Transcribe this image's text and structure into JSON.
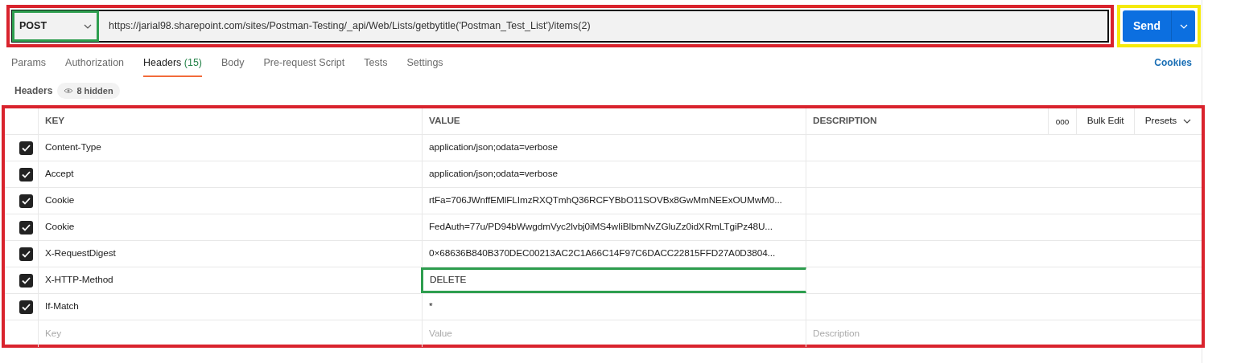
{
  "request": {
    "method": "POST",
    "url": "https://jarial98.sharepoint.com/sites/Postman-Testing/_api/Web/Lists/getbytitle('Postman_Test_List')/items(2)",
    "highlighted": true,
    "method_highlighted": true,
    "send": {
      "label": "Send",
      "highlighted": true
    }
  },
  "tabs": [
    {
      "label": "Params",
      "selected": false
    },
    {
      "label": "Authorization",
      "selected": false
    },
    {
      "label": "Headers",
      "count": "(15)",
      "selected": true
    },
    {
      "label": "Body",
      "selected": false
    },
    {
      "label": "Pre-request Script",
      "selected": false
    },
    {
      "label": "Tests",
      "selected": false
    },
    {
      "label": "Settings",
      "selected": false
    }
  ],
  "cookies_link": "Cookies",
  "headers_bar": {
    "title": "Headers",
    "hidden": "8 hidden"
  },
  "table": {
    "highlighted": true,
    "columns": [
      "KEY",
      "VALUE",
      "DESCRIPTION"
    ],
    "actions": {
      "more": "ooo",
      "bulk_edit": "Bulk Edit",
      "presets": "Presets"
    },
    "rows": [
      {
        "checked": true,
        "key": "Content-Type",
        "value": "application/json;odata=verbose"
      },
      {
        "checked": true,
        "key": "Accept",
        "value": "application/json;odata=verbose"
      },
      {
        "checked": true,
        "key": "Cookie",
        "value": "rtFa=706JWnffEMlFLImzRXQTmhQ36RCFYBbO11SOVBx8GwMmNEExOUMwM0..."
      },
      {
        "checked": true,
        "key": "Cookie",
        "value": "FedAuth=77u/PD94bWwgdmVyc2lvbj0iMS4wIiBlbmNvZGluZz0idXRmLTgiPz48U..."
      },
      {
        "checked": true,
        "key": "X-RequestDigest",
        "value": "0×68636B840B370DEC00213AC2C1A66C14F97C6DACC22815FFD27A0D3804..."
      },
      {
        "checked": true,
        "key": "X-HTTP-Method",
        "value": "DELETE",
        "value_highlighted": true
      },
      {
        "checked": true,
        "key": "If-Match",
        "value": "*"
      }
    ],
    "new_row": {
      "key_placeholder": "Key",
      "value_placeholder": "Value",
      "description_placeholder": "Description"
    }
  }
}
